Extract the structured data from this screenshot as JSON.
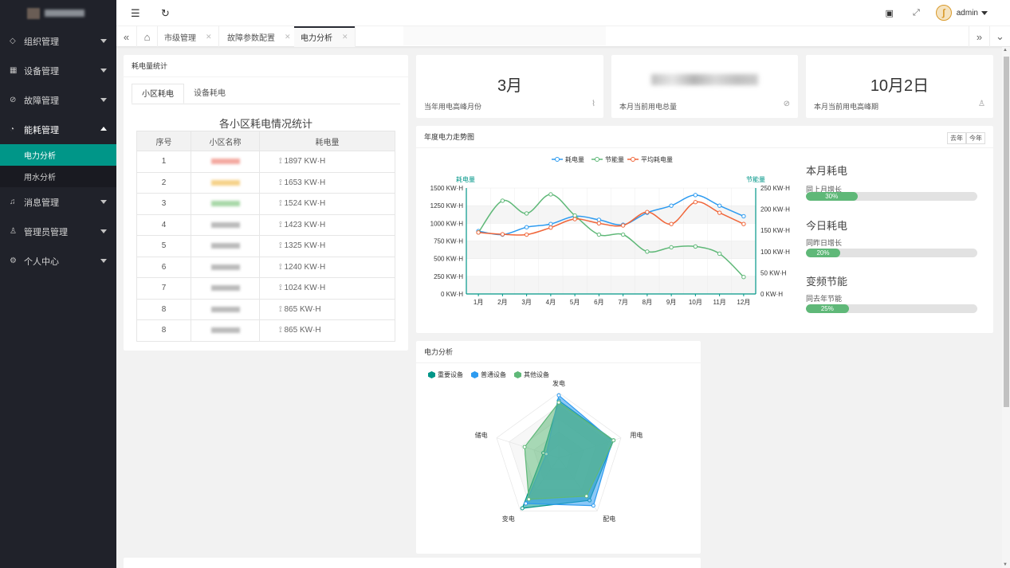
{
  "sidebar": {
    "menu": [
      {
        "label": "组织管理",
        "icon": "tag-icon"
      },
      {
        "label": "设备管理",
        "icon": "device-icon"
      },
      {
        "label": "故障管理",
        "icon": "check-circle-icon"
      },
      {
        "label": "能耗管理",
        "icon": "dashboard-icon"
      },
      {
        "label": "消息管理",
        "icon": "bell-icon"
      },
      {
        "label": "管理员管理",
        "icon": "user-icon"
      },
      {
        "label": "个人中心",
        "icon": "settings-icon"
      }
    ],
    "submenu": [
      {
        "label": "电力分析",
        "active": true
      },
      {
        "label": "用水分析",
        "active": false
      }
    ]
  },
  "header": {
    "user": "admin"
  },
  "tabs": [
    {
      "label": "市级管理"
    },
    {
      "label": "故障参数配置"
    },
    {
      "label": "电力分析",
      "active": true
    }
  ],
  "consumption": {
    "card_title": "耗电量统计",
    "subtabs": [
      "小区耗电",
      "设备耗电"
    ],
    "table_title": "各小区耗电情况统计",
    "columns": [
      "序号",
      "小区名称",
      "耗电量"
    ],
    "rows": [
      {
        "no": "1",
        "value": "1897 KW·H"
      },
      {
        "no": "2",
        "value": "1653 KW·H"
      },
      {
        "no": "3",
        "value": "1524 KW·H"
      },
      {
        "no": "4",
        "value": "1423 KW·H"
      },
      {
        "no": "5",
        "value": "1325 KW·H"
      },
      {
        "no": "6",
        "value": "1240 KW·H"
      },
      {
        "no": "7",
        "value": "1024 KW·H"
      },
      {
        "no": "8",
        "value": "865 KW·H"
      },
      {
        "no": "8",
        "value": "865 KW·H"
      }
    ]
  },
  "stats": [
    {
      "value": "3月",
      "label": "当年用电高峰月份"
    },
    {
      "value": "",
      "label": "本月当前用电总量"
    },
    {
      "value": "10月2日",
      "label": "本月当前用电高峰期"
    }
  ],
  "trend": {
    "card_title": "年度电力走势图",
    "btn_last": "去年",
    "btn_this": "今年"
  },
  "energy": [
    {
      "title": "本月耗电",
      "sub": "同上月增长",
      "percent": 30,
      "label": "30%"
    },
    {
      "title": "今日耗电",
      "sub": "同昨日增长",
      "percent": 20,
      "label": "20%"
    },
    {
      "title": "变频节能",
      "sub": "同去年节能",
      "percent": 25,
      "label": "25%"
    }
  ],
  "radar_card": {
    "title": "电力分析"
  },
  "colors": {
    "primary": "#009688",
    "blue": "#2d9bf0",
    "green": "#5fb878",
    "orange": "#f0663a",
    "sidebar": "#20222a"
  },
  "chart_data": [
    {
      "type": "line",
      "title": "",
      "categories": [
        "1月",
        "2月",
        "3月",
        "4月",
        "5月",
        "6月",
        "7月",
        "8月",
        "9月",
        "10月",
        "11月",
        "12月"
      ],
      "legend": [
        "耗电量",
        "节能量",
        "平均耗电量"
      ],
      "y_left": {
        "label": "耗电量",
        "min": 0,
        "max": 1500,
        "ticks": [
          "0 KW·H",
          "250 KW·H",
          "500 KW·H",
          "750 KW·H",
          "1000 KW·H",
          "1250 KW·H",
          "1500 KW·H"
        ]
      },
      "y_right": {
        "label": "节能量",
        "min": 0,
        "max": 250,
        "ticks": [
          "0 KW·H",
          "50 KW·H",
          "100 KW·H",
          "150 KW·H",
          "200 KW·H",
          "250 KW·H"
        ]
      },
      "series": [
        {
          "name": "耗电量",
          "axis": "left",
          "color": "#2d9bf0",
          "values": [
            890,
            840,
            945,
            990,
            1100,
            1050,
            980,
            1150,
            1250,
            1400,
            1250,
            1100
          ]
        },
        {
          "name": "节能量",
          "axis": "right",
          "color": "#5fb878",
          "values": [
            145,
            220,
            190,
            235,
            185,
            140,
            140,
            100,
            110,
            112,
            95,
            40
          ]
        },
        {
          "name": "平均耗电量",
          "axis": "left",
          "color": "#f0663a",
          "values": [
            870,
            845,
            840,
            940,
            1060,
            1000,
            970,
            1160,
            990,
            1300,
            1150,
            990
          ]
        }
      ]
    },
    {
      "type": "radar",
      "legend": [
        "重要设备",
        "普通设备",
        "其他设备"
      ],
      "indicators": [
        "发电",
        "用电",
        "配电",
        "变电",
        "储电"
      ],
      "max": 100,
      "series": [
        {
          "name": "重要设备",
          "color": "#009688",
          "values": [
            88,
            88,
            80,
            95,
            25
          ]
        },
        {
          "name": "普通设备",
          "color": "#2d9bf0",
          "values": [
            96,
            86,
            90,
            86,
            20
          ]
        },
        {
          "name": "其他设备",
          "color": "#5fb878",
          "values": [
            85,
            88,
            72,
            78,
            55
          ]
        }
      ]
    }
  ]
}
